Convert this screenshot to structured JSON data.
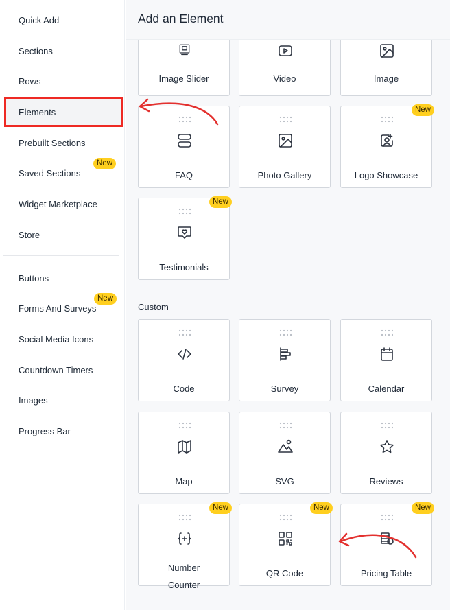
{
  "sidebar": {
    "items": [
      {
        "label": "Quick Add"
      },
      {
        "label": "Sections"
      },
      {
        "label": "Rows"
      },
      {
        "label": "Elements",
        "active": true
      },
      {
        "label": "Prebuilt Sections"
      },
      {
        "label": "Saved Sections",
        "badge": "New"
      },
      {
        "label": "Widget Marketplace"
      },
      {
        "label": "Store"
      },
      {
        "label": "Buttons"
      },
      {
        "label": "Forms And Surveys",
        "badge": "New"
      },
      {
        "label": "Social Media Icons"
      },
      {
        "label": "Countdown Timers"
      },
      {
        "label": "Images"
      },
      {
        "label": "Progress Bar"
      }
    ]
  },
  "panel": {
    "title": "Add an Element",
    "top_row": [
      {
        "label": "Image Slider",
        "icon": "image-slider-icon"
      },
      {
        "label": "Video",
        "icon": "video-icon"
      },
      {
        "label": "Image",
        "icon": "image-icon"
      }
    ],
    "elements": [
      {
        "label": "FAQ",
        "icon": "faq-icon"
      },
      {
        "label": "Photo Gallery",
        "icon": "photo-gallery-icon"
      },
      {
        "label": "Logo Showcase",
        "icon": "logo-showcase-icon",
        "badge": "New"
      },
      {
        "label": "Testimonials",
        "icon": "testimonials-icon",
        "badge": "New"
      }
    ],
    "custom_section_label": "Custom",
    "custom": [
      {
        "label": "Code",
        "icon": "code-icon"
      },
      {
        "label": "Survey",
        "icon": "survey-icon"
      },
      {
        "label": "Calendar",
        "icon": "calendar-icon"
      },
      {
        "label": "Map",
        "icon": "map-icon"
      },
      {
        "label": "SVG",
        "icon": "svg-icon"
      },
      {
        "label": "Reviews",
        "icon": "star-icon"
      },
      {
        "label": "Number Counter",
        "label_line1": "Number",
        "label_line2": "Counter",
        "icon": "number-counter-icon",
        "badge": "New"
      },
      {
        "label": "QR Code",
        "icon": "qr-code-icon",
        "badge": "New"
      },
      {
        "label": "Pricing Table",
        "icon": "pricing-table-icon",
        "badge": "New"
      }
    ]
  },
  "colors": {
    "badge": "#ffcf1f",
    "highlight": "#ee2a24",
    "arrow": "#e3312f",
    "panel_bg": "#f7f8fa"
  }
}
